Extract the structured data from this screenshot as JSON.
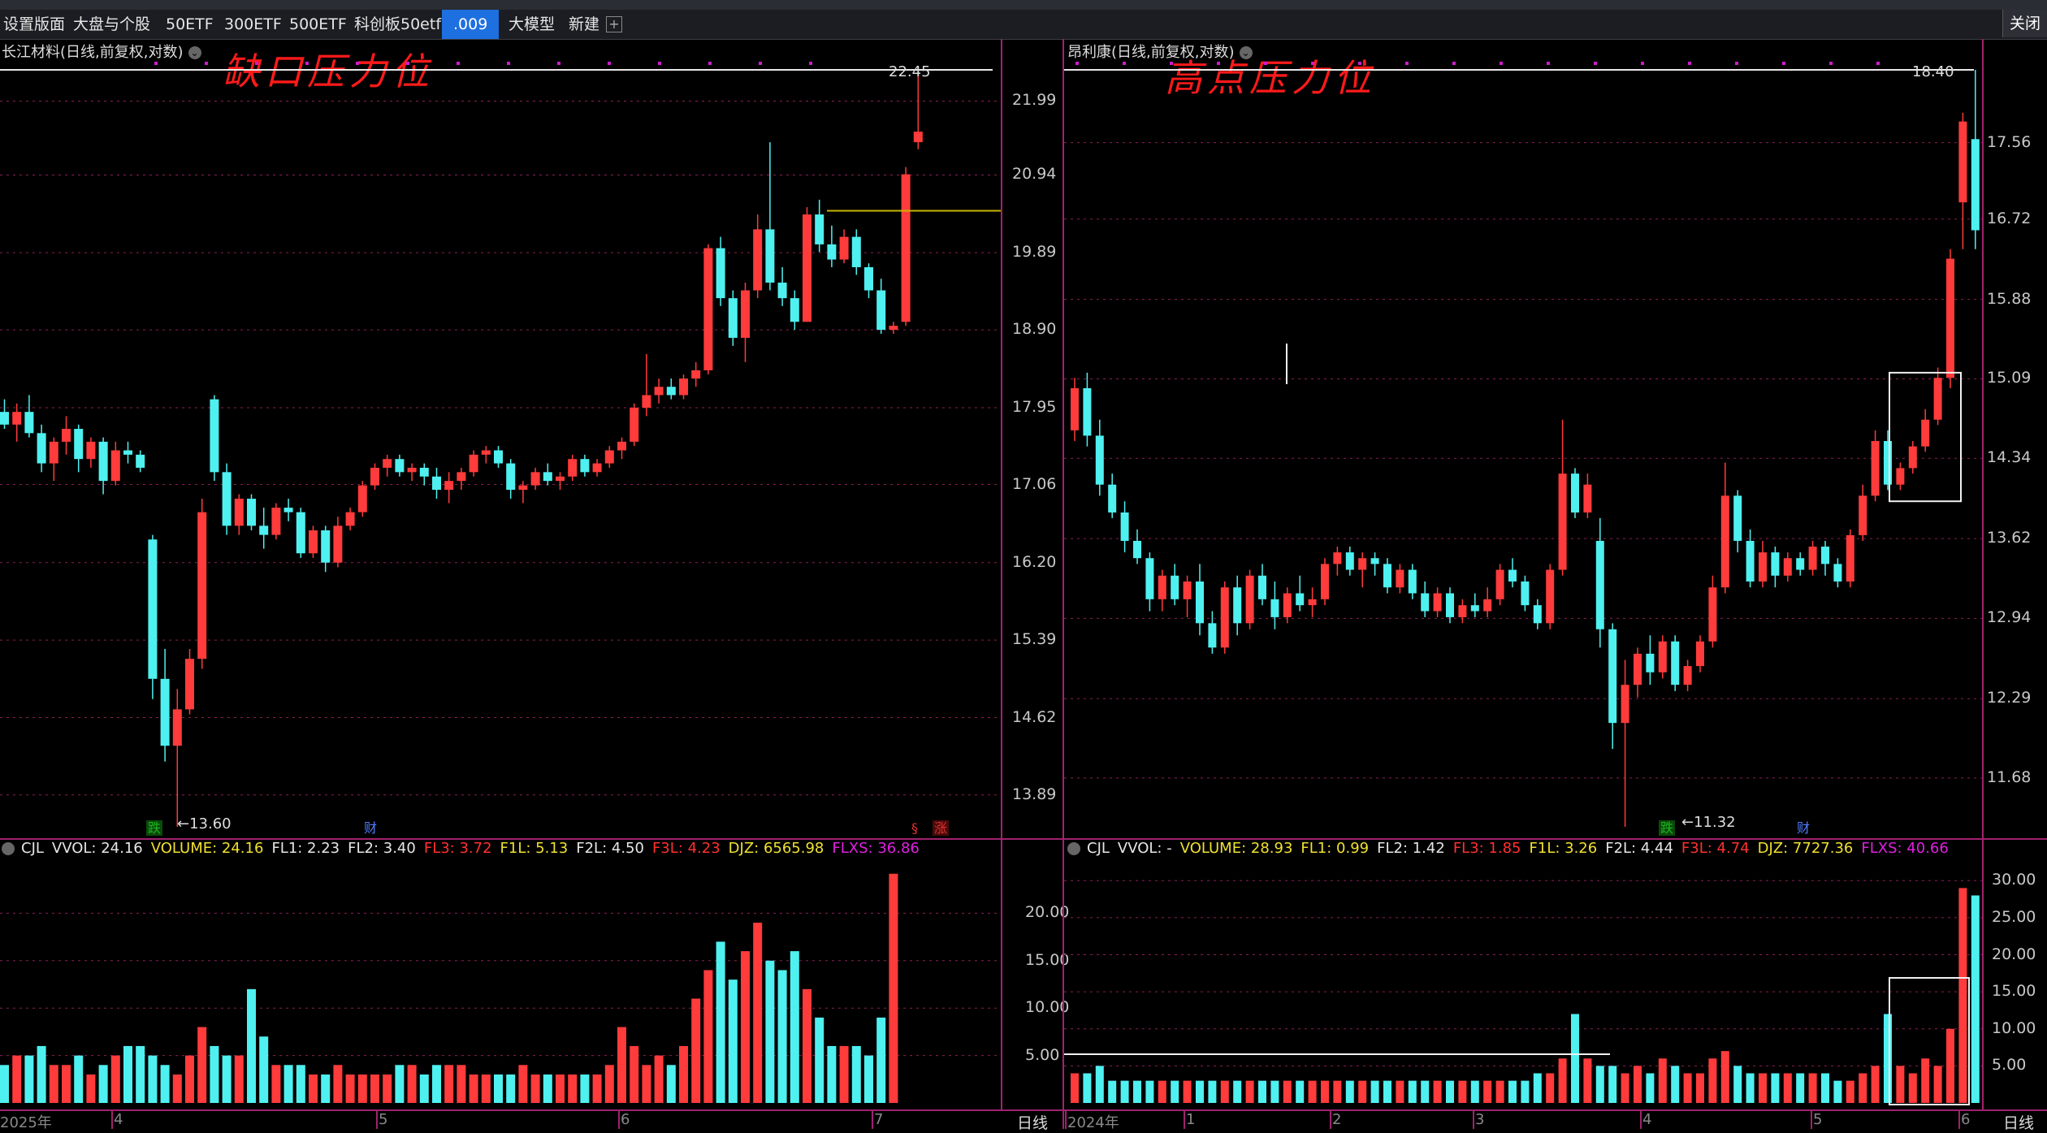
{
  "toolbar": {
    "items": [
      "设置版面",
      "大盘与个股",
      "50ETF",
      "300ETF",
      "500ETF",
      "科创板50etf",
      ".009",
      "大模型",
      "新建"
    ],
    "active_item": ".009",
    "add_icon": "plus-icon",
    "close_label": "关闭"
  },
  "left_panel": {
    "title": "长江材料(日线,前复权,对数)",
    "annotation": "缺口压力位",
    "high_label": "22.45",
    "low_label": "←13.60",
    "price_axis": [
      "21.99",
      "20.94",
      "19.89",
      "18.90",
      "17.95",
      "17.06",
      "16.20",
      "15.39",
      "14.62",
      "13.89"
    ],
    "markers": [
      {
        "text": "跌",
        "color": "#1db31d"
      },
      {
        "text": "财",
        "color": "#4f7fff"
      },
      {
        "text": "§",
        "color": "#e03030"
      },
      {
        "text": "涨",
        "color": "#e03030"
      }
    ],
    "indicator": {
      "name": "CJL",
      "items": [
        {
          "text": "VVOL: 24.16",
          "color": "#e6e6e6"
        },
        {
          "text": "VOLUME: 24.16",
          "color": "#f0e030"
        },
        {
          "text": "FL1: 2.23",
          "color": "#e6e6e6"
        },
        {
          "text": "FL2: 3.40",
          "color": "#e6e6e6"
        },
        {
          "text": "FL3: 3.72",
          "color": "#ff3030"
        },
        {
          "text": "F1L: 5.13",
          "color": "#f0e030"
        },
        {
          "text": "F2L: 4.50",
          "color": "#e6e6e6"
        },
        {
          "text": "F3L: 4.23",
          "color": "#ff3030"
        },
        {
          "text": "DJZ: 6565.98",
          "color": "#f0e030"
        },
        {
          "text": "FLXS: 36.86",
          "color": "#e020e0"
        }
      ]
    },
    "volume_axis": [
      "20.00",
      "15.00",
      "10.00",
      "5.00"
    ],
    "date_axis": [
      "2025年",
      "4",
      "5",
      "6",
      "7"
    ],
    "period_label": "日线"
  },
  "right_panel": {
    "title": "昂利康(日线,前复权,对数)",
    "annotation": "高点压力位",
    "high_label": "18.40",
    "low_label": "←11.32",
    "price_axis": [
      "17.56",
      "16.72",
      "15.88",
      "15.09",
      "14.34",
      "13.62",
      "12.94",
      "12.29",
      "11.68"
    ],
    "markers": [
      {
        "text": "跌",
        "color": "#1db31d"
      },
      {
        "text": "财",
        "color": "#4f7fff"
      }
    ],
    "indicator": {
      "name": "CJL",
      "items": [
        {
          "text": "VVOL: -",
          "color": "#e6e6e6"
        },
        {
          "text": "VOLUME: 28.93",
          "color": "#f0e030"
        },
        {
          "text": "FL1: 0.99",
          "color": "#f0e030"
        },
        {
          "text": "FL2: 1.42",
          "color": "#e6e6e6"
        },
        {
          "text": "FL3: 1.85",
          "color": "#ff3030"
        },
        {
          "text": "F1L: 3.26",
          "color": "#f0e030"
        },
        {
          "text": "F2L: 4.44",
          "color": "#e6e6e6"
        },
        {
          "text": "F3L: 4.74",
          "color": "#ff3030"
        },
        {
          "text": "DJZ: 7727.36",
          "color": "#f0e030"
        },
        {
          "text": "FLXS: 40.66",
          "color": "#e020e0"
        }
      ]
    },
    "volume_axis": [
      "30.00",
      "25.00",
      "20.00",
      "15.00",
      "10.00",
      "5.00"
    ],
    "date_axis": [
      "2024年",
      "1",
      "2",
      "3",
      "4",
      "5",
      "6"
    ],
    "period_label": "日线"
  },
  "colors": {
    "up": "#ff3b3b",
    "down": "#4ff0f0",
    "grid": "#8a1f55",
    "axis": "#a0226e",
    "background": "#000000"
  },
  "chart_data": [
    {
      "type": "candlestick",
      "title": "长江材料(日线,前复权,对数)",
      "y_scale": "log",
      "ylim": [
        13.6,
        22.45
      ],
      "x_ticks": [
        "2025年",
        "4",
        "5",
        "6",
        "7"
      ],
      "y_ticks": [
        21.99,
        20.94,
        19.89,
        18.9,
        17.95,
        17.06,
        16.2,
        15.39,
        14.62,
        13.89
      ],
      "high": 22.45,
      "low": 13.6,
      "ohlc": [
        [
          17.9,
          18.05,
          17.7,
          17.75
        ],
        [
          17.75,
          18.0,
          17.55,
          17.9
        ],
        [
          17.9,
          18.1,
          17.6,
          17.65
        ],
        [
          17.65,
          17.75,
          17.2,
          17.3
        ],
        [
          17.3,
          17.6,
          17.1,
          17.55
        ],
        [
          17.55,
          17.85,
          17.4,
          17.7
        ],
        [
          17.7,
          17.75,
          17.2,
          17.35
        ],
        [
          17.35,
          17.6,
          17.25,
          17.55
        ],
        [
          17.55,
          17.6,
          16.95,
          17.1
        ],
        [
          17.1,
          17.55,
          17.05,
          17.45
        ],
        [
          17.45,
          17.55,
          17.3,
          17.4
        ],
        [
          17.4,
          17.45,
          17.2,
          17.25
        ],
        [
          16.45,
          16.5,
          14.8,
          15.0
        ],
        [
          15.0,
          15.3,
          14.2,
          14.35
        ],
        [
          14.35,
          14.9,
          13.6,
          14.7
        ],
        [
          14.7,
          15.3,
          14.65,
          15.2
        ],
        [
          15.2,
          16.9,
          15.1,
          16.75
        ],
        [
          18.05,
          18.1,
          17.1,
          17.2
        ],
        [
          17.2,
          17.3,
          16.5,
          16.6
        ],
        [
          16.6,
          16.95,
          16.5,
          16.9
        ],
        [
          16.9,
          16.95,
          16.55,
          16.6
        ],
        [
          16.6,
          16.8,
          16.35,
          16.5
        ],
        [
          16.5,
          16.85,
          16.45,
          16.8
        ],
        [
          16.8,
          16.9,
          16.65,
          16.75
        ],
        [
          16.75,
          16.8,
          16.25,
          16.3
        ],
        [
          16.3,
          16.6,
          16.25,
          16.55
        ],
        [
          16.55,
          16.6,
          16.1,
          16.2
        ],
        [
          16.2,
          16.7,
          16.15,
          16.6
        ],
        [
          16.6,
          16.8,
          16.55,
          16.75
        ],
        [
          16.75,
          17.1,
          16.7,
          17.05
        ],
        [
          17.05,
          17.3,
          17.0,
          17.25
        ],
        [
          17.25,
          17.4,
          17.15,
          17.35
        ],
        [
          17.35,
          17.4,
          17.15,
          17.2
        ],
        [
          17.2,
          17.3,
          17.1,
          17.25
        ],
        [
          17.25,
          17.3,
          17.05,
          17.15
        ],
        [
          17.15,
          17.25,
          16.9,
          17.0
        ],
        [
          17.0,
          17.2,
          16.85,
          17.1
        ],
        [
          17.1,
          17.25,
          17.0,
          17.2
        ],
        [
          17.2,
          17.45,
          17.15,
          17.4
        ],
        [
          17.4,
          17.5,
          17.3,
          17.45
        ],
        [
          17.45,
          17.5,
          17.25,
          17.3
        ],
        [
          17.3,
          17.35,
          16.9,
          17.0
        ],
        [
          17.0,
          17.1,
          16.85,
          17.05
        ],
        [
          17.05,
          17.25,
          17.0,
          17.2
        ],
        [
          17.2,
          17.3,
          17.05,
          17.1
        ],
        [
          17.1,
          17.2,
          17.0,
          17.15
        ],
        [
          17.15,
          17.4,
          17.1,
          17.35
        ],
        [
          17.35,
          17.4,
          17.15,
          17.2
        ],
        [
          17.2,
          17.35,
          17.15,
          17.3
        ],
        [
          17.3,
          17.5,
          17.25,
          17.45
        ],
        [
          17.45,
          17.6,
          17.35,
          17.55
        ],
        [
          17.55,
          18.0,
          17.5,
          17.95
        ],
        [
          17.95,
          18.6,
          17.85,
          18.1
        ],
        [
          18.1,
          18.3,
          18.0,
          18.2
        ],
        [
          18.2,
          18.3,
          18.05,
          18.1
        ],
        [
          18.1,
          18.35,
          18.05,
          18.3
        ],
        [
          18.3,
          18.5,
          18.2,
          18.4
        ],
        [
          18.4,
          20.0,
          18.35,
          19.95
        ],
        [
          19.95,
          20.1,
          19.2,
          19.3
        ],
        [
          19.3,
          19.4,
          18.7,
          18.8
        ],
        [
          18.8,
          19.5,
          18.5,
          19.4
        ],
        [
          19.4,
          20.4,
          19.3,
          20.2
        ],
        [
          20.2,
          21.4,
          19.4,
          19.5
        ],
        [
          19.5,
          19.7,
          19.2,
          19.3
        ],
        [
          19.3,
          19.4,
          18.9,
          19.0
        ],
        [
          19.0,
          20.5,
          19.0,
          20.4
        ],
        [
          20.4,
          20.6,
          19.9,
          20.0
        ],
        [
          20.0,
          20.25,
          19.7,
          19.8
        ],
        [
          19.8,
          20.2,
          19.75,
          20.1
        ],
        [
          20.1,
          20.2,
          19.6,
          19.7
        ],
        [
          19.7,
          19.75,
          19.3,
          19.4
        ],
        [
          19.4,
          19.55,
          18.85,
          18.9
        ],
        [
          18.9,
          19.0,
          18.85,
          18.95
        ],
        [
          19.0,
          21.05,
          18.95,
          20.95
        ],
        [
          21.4,
          22.45,
          21.3,
          21.55
        ]
      ],
      "volume": [
        4,
        5,
        5,
        6,
        4,
        4,
        5,
        3,
        4,
        5,
        6,
        6,
        5,
        4,
        3,
        5,
        8,
        6,
        5,
        5,
        12,
        7,
        4,
        4,
        4,
        3,
        3,
        4,
        3,
        3,
        3,
        3,
        4,
        4,
        3,
        4,
        4,
        4,
        3,
        3,
        3,
        3,
        4,
        3,
        3,
        3,
        3,
        3,
        3,
        4,
        8,
        6,
        4,
        5,
        4,
        6,
        11,
        14,
        17,
        13,
        16,
        19,
        15,
        14,
        16,
        12,
        9,
        6,
        6,
        6,
        5,
        9,
        24.16
      ],
      "volume_ylim": [
        0,
        25
      ],
      "volume_ticks": [
        20.0,
        15.0,
        10.0,
        5.0
      ]
    },
    {
      "type": "candlestick",
      "title": "昂利康(日线,前复权,对数)",
      "y_scale": "log",
      "ylim": [
        11.32,
        18.4
      ],
      "x_ticks": [
        "2024年",
        "1",
        "2",
        "3",
        "4",
        "5",
        "6"
      ],
      "y_ticks": [
        17.56,
        16.72,
        15.88,
        15.09,
        14.34,
        13.62,
        12.94,
        12.29,
        11.68
      ],
      "high": 18.4,
      "low": 11.32,
      "ohlc": [
        [
          14.6,
          15.1,
          14.5,
          15.0
        ],
        [
          15.0,
          15.15,
          14.45,
          14.55
        ],
        [
          14.55,
          14.7,
          14.0,
          14.1
        ],
        [
          14.1,
          14.2,
          13.8,
          13.85
        ],
        [
          13.85,
          13.95,
          13.5,
          13.6
        ],
        [
          13.6,
          13.7,
          13.4,
          13.45
        ],
        [
          13.45,
          13.5,
          13.0,
          13.1
        ],
        [
          13.1,
          13.35,
          13.0,
          13.3
        ],
        [
          13.3,
          13.4,
          13.05,
          13.1
        ],
        [
          13.1,
          13.3,
          12.95,
          13.25
        ],
        [
          13.25,
          13.4,
          12.8,
          12.9
        ],
        [
          12.9,
          13.0,
          12.65,
          12.7
        ],
        [
          12.7,
          13.25,
          12.65,
          13.2
        ],
        [
          13.2,
          13.3,
          12.8,
          12.9
        ],
        [
          12.9,
          13.35,
          12.85,
          13.3
        ],
        [
          13.3,
          13.4,
          13.05,
          13.1
        ],
        [
          13.1,
          13.25,
          12.85,
          12.95
        ],
        [
          12.95,
          13.2,
          12.9,
          13.15
        ],
        [
          13.15,
          13.3,
          13.0,
          13.05
        ],
        [
          13.05,
          13.2,
          12.95,
          13.1
        ],
        [
          13.1,
          13.45,
          13.05,
          13.4
        ],
        [
          13.4,
          13.55,
          13.3,
          13.5
        ],
        [
          13.5,
          13.55,
          13.3,
          13.35
        ],
        [
          13.35,
          13.5,
          13.2,
          13.45
        ],
        [
          13.45,
          13.5,
          13.3,
          13.4
        ],
        [
          13.4,
          13.45,
          13.15,
          13.2
        ],
        [
          13.2,
          13.4,
          13.15,
          13.35
        ],
        [
          13.35,
          13.4,
          13.1,
          13.15
        ],
        [
          13.15,
          13.25,
          12.95,
          13.0
        ],
        [
          13.0,
          13.2,
          12.95,
          13.15
        ],
        [
          13.15,
          13.2,
          12.9,
          12.95
        ],
        [
          12.95,
          13.1,
          12.9,
          13.05
        ],
        [
          13.05,
          13.15,
          12.95,
          13.0
        ],
        [
          13.0,
          13.2,
          12.95,
          13.1
        ],
        [
          13.1,
          13.4,
          13.05,
          13.35
        ],
        [
          13.35,
          13.45,
          13.2,
          13.25
        ],
        [
          13.25,
          13.3,
          13.0,
          13.05
        ],
        [
          13.05,
          13.1,
          12.85,
          12.9
        ],
        [
          12.9,
          13.4,
          12.85,
          13.35
        ],
        [
          13.35,
          14.7,
          13.3,
          14.2
        ],
        [
          14.2,
          14.25,
          13.8,
          13.85
        ],
        [
          13.85,
          14.2,
          13.8,
          14.1
        ],
        [
          13.6,
          13.8,
          12.7,
          12.85
        ],
        [
          12.85,
          12.9,
          11.9,
          12.1
        ],
        [
          12.1,
          12.6,
          11.32,
          12.4
        ],
        [
          12.4,
          12.7,
          12.3,
          12.65
        ],
        [
          12.65,
          12.8,
          12.4,
          12.5
        ],
        [
          12.5,
          12.8,
          12.45,
          12.75
        ],
        [
          12.75,
          12.8,
          12.35,
          12.4
        ],
        [
          12.4,
          12.6,
          12.35,
          12.55
        ],
        [
          12.55,
          12.8,
          12.5,
          12.75
        ],
        [
          12.75,
          13.3,
          12.7,
          13.2
        ],
        [
          13.2,
          14.3,
          13.15,
          14.0
        ],
        [
          14.0,
          14.05,
          13.5,
          13.6
        ],
        [
          13.6,
          13.7,
          13.2,
          13.25
        ],
        [
          13.25,
          13.6,
          13.2,
          13.5
        ],
        [
          13.5,
          13.55,
          13.2,
          13.3
        ],
        [
          13.3,
          13.5,
          13.25,
          13.45
        ],
        [
          13.45,
          13.5,
          13.3,
          13.35
        ],
        [
          13.35,
          13.6,
          13.3,
          13.55
        ],
        [
          13.55,
          13.6,
          13.3,
          13.4
        ],
        [
          13.4,
          13.45,
          13.2,
          13.25
        ],
        [
          13.25,
          13.7,
          13.2,
          13.65
        ],
        [
          13.65,
          14.1,
          13.6,
          14.0
        ],
        [
          14.0,
          14.6,
          13.95,
          14.5
        ],
        [
          14.5,
          14.6,
          14.05,
          14.1
        ],
        [
          14.1,
          14.3,
          14.05,
          14.25
        ],
        [
          14.25,
          14.5,
          14.2,
          14.45
        ],
        [
          14.45,
          14.8,
          14.4,
          14.7
        ],
        [
          14.7,
          15.2,
          14.65,
          15.1
        ],
        [
          15.1,
          16.4,
          15.0,
          16.3
        ],
        [
          16.9,
          17.9,
          16.4,
          17.8
        ],
        [
          17.6,
          18.4,
          16.4,
          16.6
        ]
      ],
      "volume": [
        4,
        4,
        5,
        3,
        3,
        3,
        3,
        3,
        3,
        3,
        3,
        3,
        3,
        3,
        3,
        3,
        3,
        3,
        3,
        3,
        3,
        3,
        3,
        3,
        3,
        3,
        3,
        3,
        3,
        3,
        3,
        3,
        3,
        3,
        3,
        3,
        3,
        4,
        4,
        6,
        12,
        6,
        5,
        5,
        4,
        5,
        4,
        6,
        5,
        4,
        4,
        6,
        7,
        5,
        4,
        4,
        4,
        4,
        4,
        4,
        4,
        3,
        3,
        4,
        5,
        12,
        5,
        4,
        6,
        5,
        10,
        29.0,
        28.0
      ],
      "volume_ylim": [
        0,
        32
      ],
      "volume_ticks": [
        30.0,
        25.0,
        20.0,
        15.0,
        10.0,
        5.0
      ]
    }
  ]
}
